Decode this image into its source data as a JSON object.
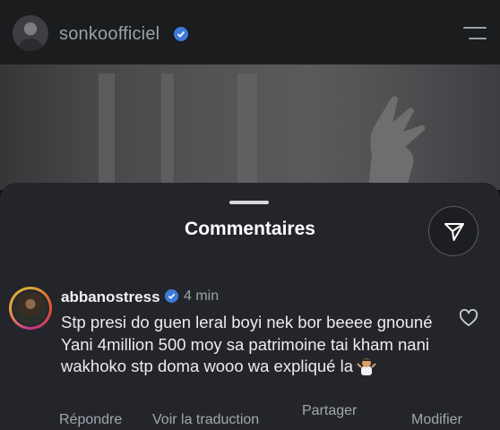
{
  "header": {
    "username": "sonkoofficiel",
    "avatar_icon": "profile-avatar",
    "verified_icon": "verified-badge-icon",
    "menu_icon": "hamburger-menu-icon"
  },
  "sheet": {
    "title": "Commentaires",
    "send_icon": "paper-plane-icon"
  },
  "comment": {
    "username": "abbanostress",
    "time": "4 min",
    "text": "Stp presi do guen leral boyi nek bor beeee gnouné Yani 4million 500 moy sa patrimoine tai kham nani wakhoko stp doma wooo wa expliqué la",
    "emoji": "person-shrugging-emoji",
    "like_icon": "heart-icon"
  },
  "actions": {
    "reply": "Répondre",
    "translate": "Voir la traduction",
    "share": "Partager",
    "edit": "Modifier"
  },
  "colors": {
    "sheet_bg": "#23252a",
    "verified": "#3d7bd9",
    "secondary_text": "#9ea2a8"
  }
}
